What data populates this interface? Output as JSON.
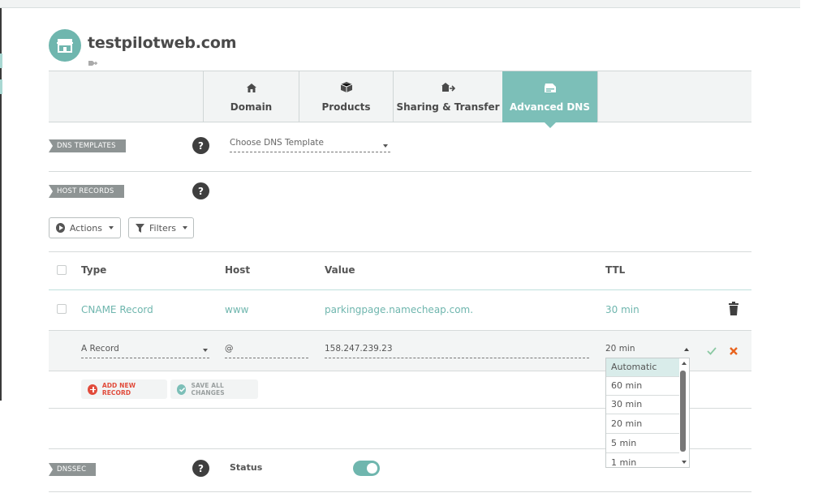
{
  "domain": {
    "name": "testpilotweb.com"
  },
  "tabs": [
    {
      "label": "Domain",
      "icon": "home-icon"
    },
    {
      "label": "Products",
      "icon": "box-icon"
    },
    {
      "label": "Sharing & Transfer",
      "icon": "share-transfer-icon"
    },
    {
      "label": "Advanced DNS",
      "icon": "dns-server-icon",
      "active": true
    }
  ],
  "sections": {
    "dns_templates": "DNS TEMPLATES",
    "host_records": "HOST RECORDS",
    "dnssec": "DNSSEC"
  },
  "dns_template": {
    "placeholder": "Choose DNS Template"
  },
  "toolbar": {
    "actions_label": "Actions",
    "filters_label": "Filters"
  },
  "table": {
    "columns": {
      "type": "Type",
      "host": "Host",
      "value": "Value",
      "ttl": "TTL"
    },
    "records": [
      {
        "type": "CNAME Record",
        "host": "www",
        "value": "parkingpage.namecheap.com.",
        "ttl": "30 min"
      }
    ],
    "editing": {
      "type": "A Record",
      "host": "@",
      "value": "158.247.239.23",
      "ttl": "20 min"
    }
  },
  "buttons": {
    "add_new_record": "ADD NEW RECORD",
    "save_all_changes": "SAVE ALL CHANGES"
  },
  "ttl_options": [
    "Automatic",
    "60 min",
    "30 min",
    "20 min",
    "5 min",
    "1 min"
  ],
  "ttl_selected_option": "Automatic",
  "dnssec": {
    "status_label": "Status",
    "enabled": true
  },
  "help_glyph": "?",
  "colors": {
    "accent": "#7cbfb8",
    "teal_text": "#6fb6ae",
    "add_red": "#e14b3b",
    "cancel_orange": "#e8641f",
    "confirm_green": "#8bc9a3"
  }
}
